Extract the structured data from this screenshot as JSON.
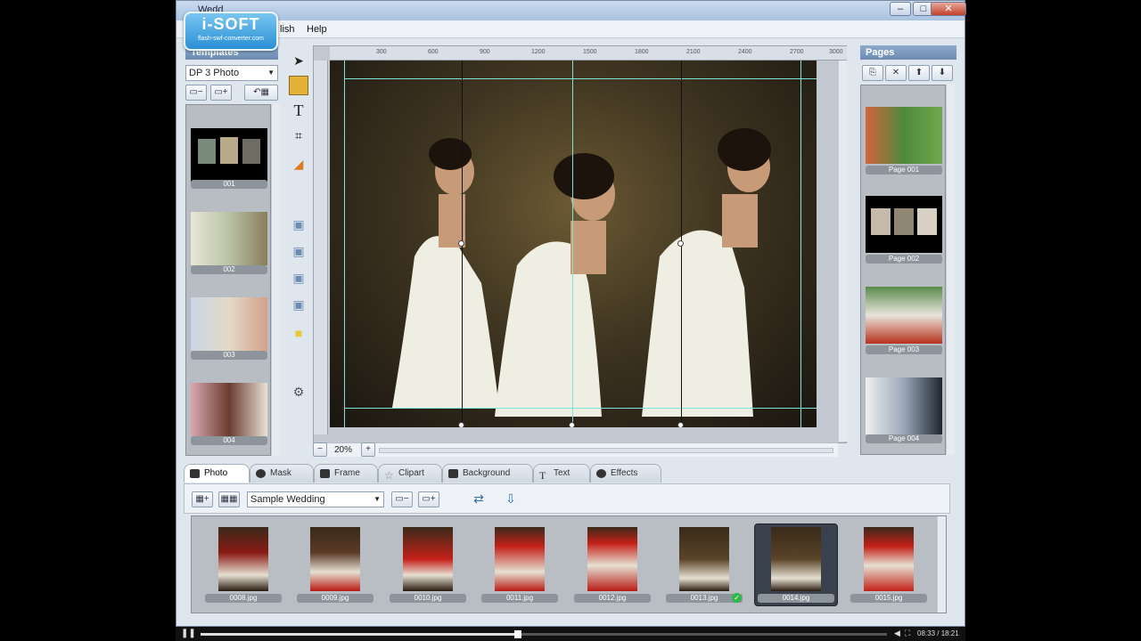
{
  "window": {
    "title": "Wedd"
  },
  "logo": {
    "brand": "i-SOFT",
    "tagline": "flash-swf-converter.com"
  },
  "menu": [
    "lish",
    "Help"
  ],
  "templates": {
    "header": "Templates",
    "selected": "DP 3 Photo",
    "items": [
      {
        "label": "001"
      },
      {
        "label": "002"
      },
      {
        "label": "003"
      },
      {
        "label": "004"
      }
    ]
  },
  "canvas": {
    "ruler_marks": [
      "300",
      "600",
      "900",
      "1200",
      "1500",
      "1800",
      "2100",
      "2400",
      "2700",
      "3000"
    ],
    "zoom": "20%"
  },
  "pages": {
    "header": "Pages",
    "items": [
      {
        "label": "Page 001"
      },
      {
        "label": "Page 002"
      },
      {
        "label": "Page 003"
      },
      {
        "label": "Page 004"
      }
    ]
  },
  "tabs": [
    "Photo",
    "Mask",
    "Frame",
    "Clipart",
    "Background",
    "Text",
    "Effects"
  ],
  "photo_panel": {
    "album": "Sample Wedding",
    "files": [
      {
        "name": "0008.jpg"
      },
      {
        "name": "0009.jpg"
      },
      {
        "name": "0010.jpg"
      },
      {
        "name": "0011.jpg"
      },
      {
        "name": "0012.jpg"
      },
      {
        "name": "0013.jpg"
      },
      {
        "name": "0014.jpg"
      },
      {
        "name": "0015.jpg"
      }
    ]
  },
  "player": {
    "time": "08:33 / 18:21"
  },
  "colors": {
    "guide": "#7fe3d8",
    "accent": "#6d8cb3"
  }
}
